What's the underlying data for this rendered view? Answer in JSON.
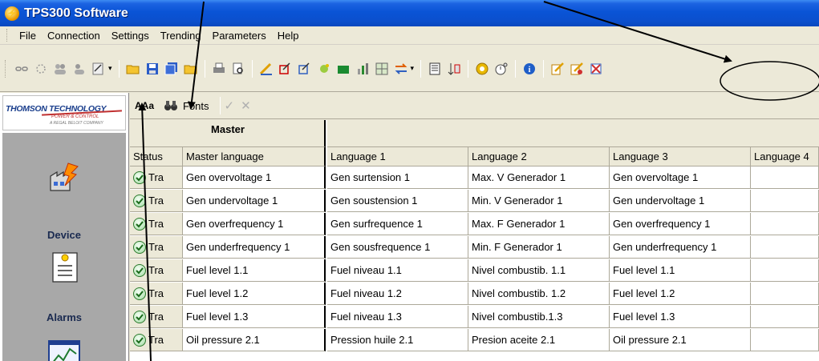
{
  "window": {
    "title": "TPS300 Software"
  },
  "menu": [
    "File",
    "Connection",
    "Settings",
    "Trending",
    "Parameters",
    "Help"
  ],
  "toolbar_icons": [
    "link-icon",
    "disconnect-icon",
    "users-icon",
    "group-icon",
    "wizard-icon",
    "open-folder-icon",
    "save-icon",
    "save-all-icon",
    "open-icon",
    "print-icon",
    "print-preview-icon",
    "edit-icon",
    "edit-check-icon",
    "edit-arrow-icon",
    "sparkle-icon",
    "green-bar-icon",
    "chart-icon",
    "grid-settings-icon",
    "transfer-icon",
    "page-icon",
    "sort-icon",
    "settings-gear-icon",
    "timer-icon",
    "info-icon",
    "translate-edit-icon",
    "translate-apply-icon",
    "translate-reset-icon"
  ],
  "logo": {
    "main": "THOMSON TECHNOLOGY",
    "sub": "POWER & CONTROL",
    "sub2": "A REGAL BELOIT COMPANY"
  },
  "nav": [
    {
      "label": "Device",
      "icon": "factory-lightning-icon"
    },
    {
      "label": "Alarms",
      "icon": "alarm-document-icon"
    },
    {
      "label": "",
      "icon": "trend-chart-icon"
    }
  ],
  "subtoolbar": {
    "fonts_label": "Fonts"
  },
  "grid": {
    "group_label": "Master",
    "columns": [
      "Status",
      "Master language",
      "Language 1",
      "Language 2",
      "Language 3",
      "Language 4"
    ],
    "rows": [
      {
        "status": "Tra",
        "master": "Gen overvoltage 1",
        "l1": "Gen surtension 1",
        "l2": "Max. V Generador 1",
        "l3": "Gen overvoltage 1",
        "l4": ""
      },
      {
        "status": "Tra",
        "master": "Gen undervoltage 1",
        "l1": "Gen soustension 1",
        "l2": "Min. V Generador 1",
        "l3": "Gen undervoltage 1",
        "l4": ""
      },
      {
        "status": "Tra",
        "master": "Gen overfrequency 1",
        "l1": "Gen surfrequence 1",
        "l2": "Max. F Generador 1",
        "l3": "Gen overfrequency 1",
        "l4": ""
      },
      {
        "status": "Tra",
        "master": "Gen underfrequency 1",
        "l1": "Gen sousfrequence 1",
        "l2": "Min. F Generador 1",
        "l3": "Gen underfrequency 1",
        "l4": ""
      },
      {
        "status": "Tra",
        "master": "Fuel level 1.1",
        "l1": "Fuel niveau 1.1",
        "l2": "Nivel combustib. 1.1",
        "l3": "Fuel level 1.1",
        "l4": ""
      },
      {
        "status": "Tra",
        "master": "Fuel level 1.2",
        "l1": "Fuel niveau 1.2",
        "l2": "Nivel combustib. 1.2",
        "l3": "Fuel level 1.2",
        "l4": ""
      },
      {
        "status": "Tra",
        "master": "Fuel level 1.3",
        "l1": "Fuel niveau 1.3",
        "l2": "Nivel combustib.1.3",
        "l3": "Fuel level 1.3",
        "l4": ""
      },
      {
        "status": "Tra",
        "master": "Oil pressure 2.1",
        "l1": "Pression huile 2.1",
        "l2": "Presion aceite 2.1",
        "l3": "Oil pressure 2.1",
        "l4": ""
      }
    ]
  }
}
